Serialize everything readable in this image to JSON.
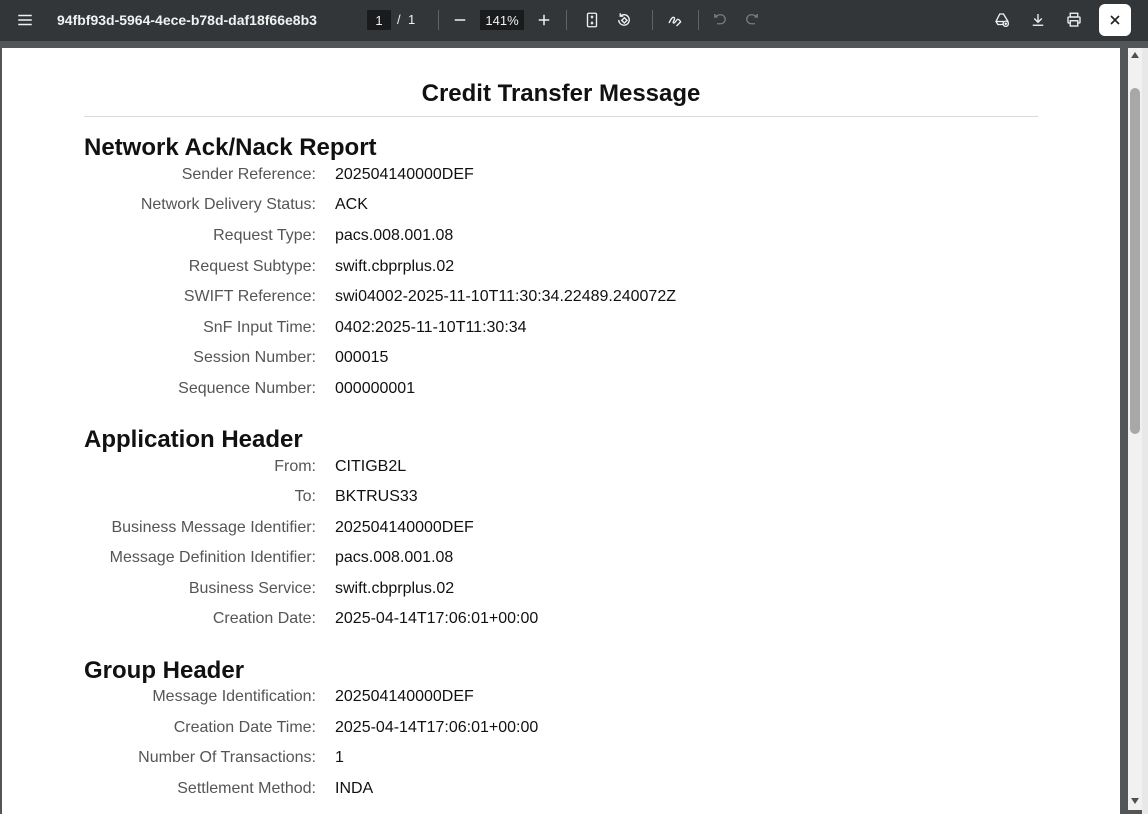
{
  "toolbar": {
    "doc_title": "94fbf93d-5964-4ece-b78d-daf18f66e8b3",
    "page_current": "1",
    "page_separator": "/",
    "page_total": "1",
    "zoom": "141%"
  },
  "icons": {
    "menu": "menu-icon",
    "zoom_out": "minus-icon",
    "zoom_in": "plus-icon",
    "fit": "fit-page-icon",
    "rotate": "rotate-icon",
    "draw": "draw-icon",
    "undo": "undo-icon",
    "redo": "redo-icon",
    "drive": "drive-add-icon",
    "download": "download-icon",
    "print": "print-icon",
    "close": "close-icon"
  },
  "document": {
    "title": "Credit Transfer Message",
    "sections": [
      {
        "title": "Network Ack/Nack Report",
        "rows": [
          {
            "label": "Sender Reference:",
            "value": "202504140000DEF"
          },
          {
            "label": "Network Delivery Status:",
            "value": "ACK"
          },
          {
            "label": "Request Type:",
            "value": "pacs.008.001.08"
          },
          {
            "label": "Request Subtype:",
            "value": "swift.cbprplus.02"
          },
          {
            "label": "SWIFT Reference:",
            "value": "swi04002-2025-11-10T11:30:34.22489.240072Z"
          },
          {
            "label": "SnF Input Time:",
            "value": "0402:2025-11-10T11:30:34"
          },
          {
            "label": "Session Number:",
            "value": "000015"
          },
          {
            "label": "Sequence Number:",
            "value": "000000001"
          }
        ]
      },
      {
        "title": "Application Header",
        "rows": [
          {
            "label": "From:",
            "value": "CITIGB2L"
          },
          {
            "label": "To:",
            "value": "BKTRUS33"
          },
          {
            "label": "Business Message Identifier:",
            "value": "202504140000DEF"
          },
          {
            "label": "Message Definition Identifier:",
            "value": "pacs.008.001.08"
          },
          {
            "label": "Business Service:",
            "value": "swift.cbprplus.02"
          },
          {
            "label": "Creation Date:",
            "value": "2025-04-14T17:06:01+00:00"
          }
        ]
      },
      {
        "title": "Group Header",
        "rows": [
          {
            "label": "Message Identification:",
            "value": "202504140000DEF"
          },
          {
            "label": "Creation Date Time:",
            "value": "2025-04-14T17:06:01+00:00"
          },
          {
            "label": "Number Of Transactions:",
            "value": "1"
          },
          {
            "label": "Settlement Method:",
            "value": "INDA"
          }
        ]
      }
    ]
  }
}
